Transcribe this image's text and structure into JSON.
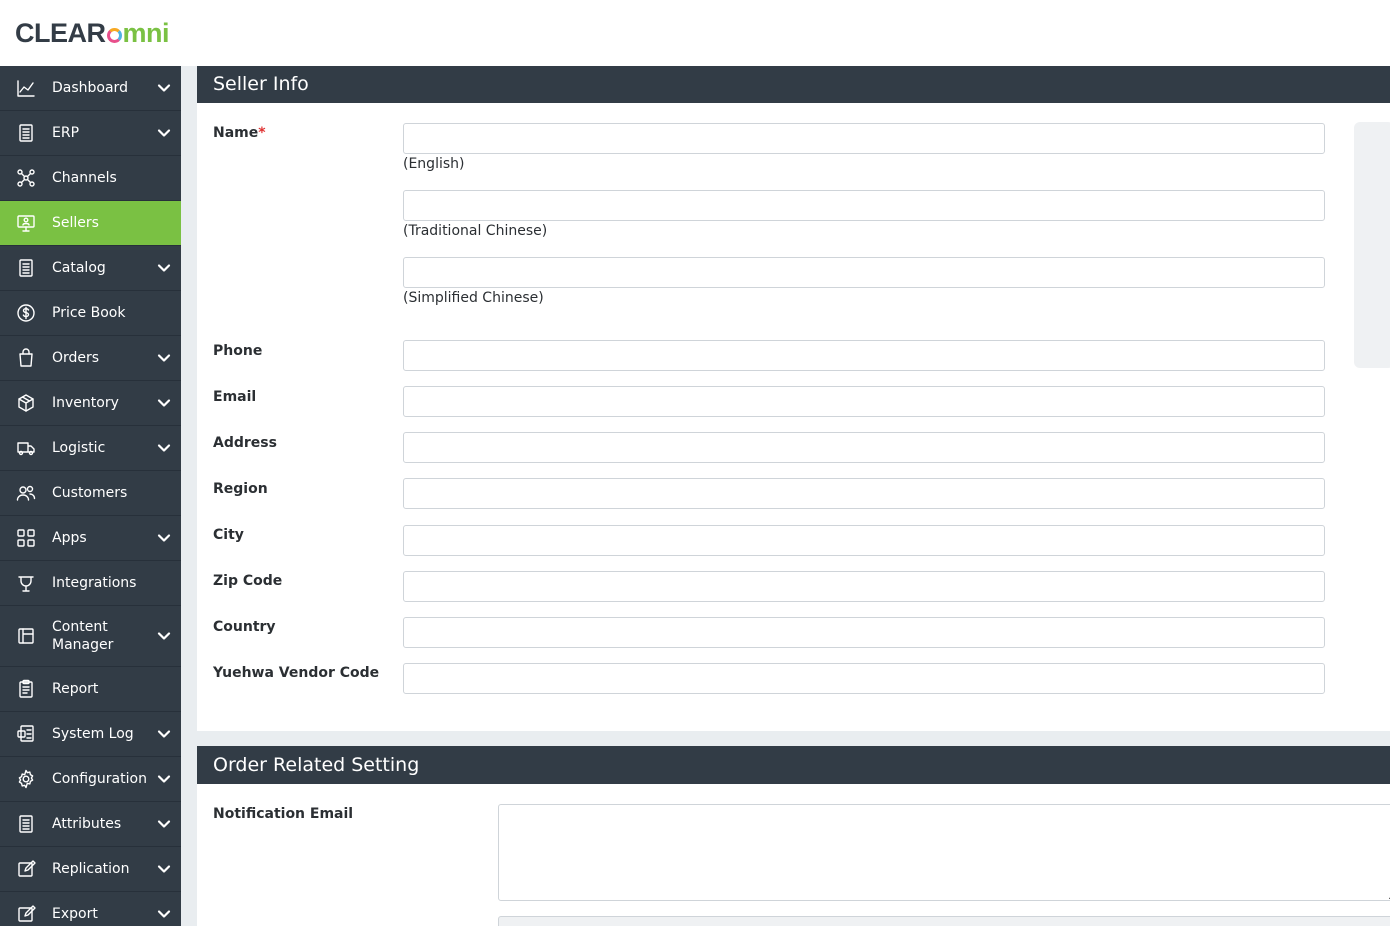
{
  "brand": {
    "clear": "CLEAR",
    "omni": "mni"
  },
  "sidebar": {
    "items": [
      {
        "label": "Dashboard",
        "icon": "chart-line-icon",
        "expandable": true
      },
      {
        "label": "ERP",
        "icon": "document-list-icon",
        "expandable": true
      },
      {
        "label": "Channels",
        "icon": "network-icon",
        "expandable": false
      },
      {
        "label": "Sellers",
        "icon": "monitor-user-icon",
        "expandable": false,
        "active": true
      },
      {
        "label": "Catalog",
        "icon": "document-list-icon",
        "expandable": true
      },
      {
        "label": "Price Book",
        "icon": "dollar-circle-icon",
        "expandable": false
      },
      {
        "label": "Orders",
        "icon": "shopping-bag-icon",
        "expandable": true
      },
      {
        "label": "Inventory",
        "icon": "box-icon",
        "expandable": true
      },
      {
        "label": "Logistic",
        "icon": "truck-icon",
        "expandable": true
      },
      {
        "label": "Customers",
        "icon": "users-icon",
        "expandable": false
      },
      {
        "label": "Apps",
        "icon": "grid-icon",
        "expandable": true
      },
      {
        "label": "Integrations",
        "icon": "plug-icon",
        "expandable": false
      },
      {
        "label": "Content\nManager",
        "label_line1": "Content",
        "label_line2": "Manager",
        "icon": "layout-icon",
        "expandable": true
      },
      {
        "label": "Report",
        "icon": "clipboard-icon",
        "expandable": false
      },
      {
        "label": "System Log",
        "icon": "log-icon",
        "expandable": true
      },
      {
        "label": "Configuration",
        "icon": "gear-icon",
        "expandable": true
      },
      {
        "label": "Attributes",
        "icon": "document-list-icon",
        "expandable": true
      },
      {
        "label": "Replication",
        "icon": "edit-icon",
        "expandable": true
      },
      {
        "label": "Export",
        "icon": "edit-icon",
        "expandable": true
      }
    ]
  },
  "seller_info": {
    "title": "Seller Info",
    "name_label": "Name",
    "required_mark": "*",
    "name_english_hint": "(English)",
    "name_trad_chinese_hint": "(Traditional Chinese)",
    "name_simp_chinese_hint": "(Simplified Chinese)",
    "name_english_value": "",
    "name_trad_chinese_value": "",
    "name_simp_chinese_value": "",
    "phone_label": "Phone",
    "phone_value": "",
    "email_label": "Email",
    "email_value": "",
    "address_label": "Address",
    "address_value": "",
    "region_label": "Region",
    "region_value": "",
    "city_label": "City",
    "city_value": "",
    "zip_label": "Zip Code",
    "zip_value": "",
    "country_label": "Country",
    "country_value": "",
    "vendor_code_label": "Yuehwa Vendor Code",
    "vendor_code_value": ""
  },
  "order_settings": {
    "title": "Order Related Setting",
    "notification_email_label": "Notification Email",
    "notification_email_value": ""
  },
  "colors": {
    "sidebar_bg": "#323c46",
    "active_item": "#7ac143",
    "header_bg": "#323c46",
    "required": "#e03131"
  }
}
